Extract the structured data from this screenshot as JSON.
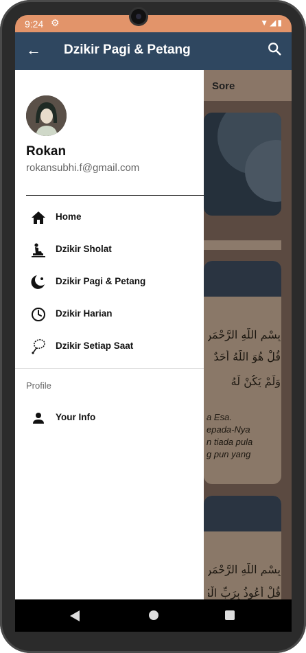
{
  "status_bar": {
    "time": "9:24"
  },
  "app_bar": {
    "title": "Dzikir Pagi & Petang"
  },
  "background": {
    "tab_label": "Sore",
    "arabic_lines": [
      "بِسْمِ اللَّهِ الرَّحْمَنِ الرَّحِيمِ",
      "قُلْ هُوَ اللَّهُ أَحَدٌ",
      "وَلَمْ يَكُنْ لَهُ"
    ],
    "arabic_lines_2": [
      "بِسْمِ اللَّهِ الرَّحْمَنِ الرَّحِيمِ",
      "قُلْ أَعُوذُ بِرَبِّ الْفَلَقِ"
    ],
    "translation_lines": [
      "a Esa.",
      "epada-Nya",
      "n tiada pula",
      "g pun yang"
    ]
  },
  "drawer": {
    "user": {
      "name": "Rokan",
      "email": "rokansubhi.f@gmail.com"
    },
    "menu": [
      {
        "label": "Home",
        "icon": "home-icon"
      },
      {
        "label": "Dzikir Sholat",
        "icon": "prayer-icon"
      },
      {
        "label": "Dzikir Pagi & Petang",
        "icon": "moon-sun-icon"
      },
      {
        "label": "Dzikir Harian",
        "icon": "clock-icon"
      },
      {
        "label": "Dzikir Setiap Saat",
        "icon": "prayer-beads-icon"
      }
    ],
    "section_label": "Profile",
    "profile_item": {
      "label": "Your Info",
      "icon": "person-icon"
    }
  },
  "colors": {
    "status_bar": "#e2946a",
    "app_bar": "#2f4760",
    "drawer": "#ffffff"
  }
}
